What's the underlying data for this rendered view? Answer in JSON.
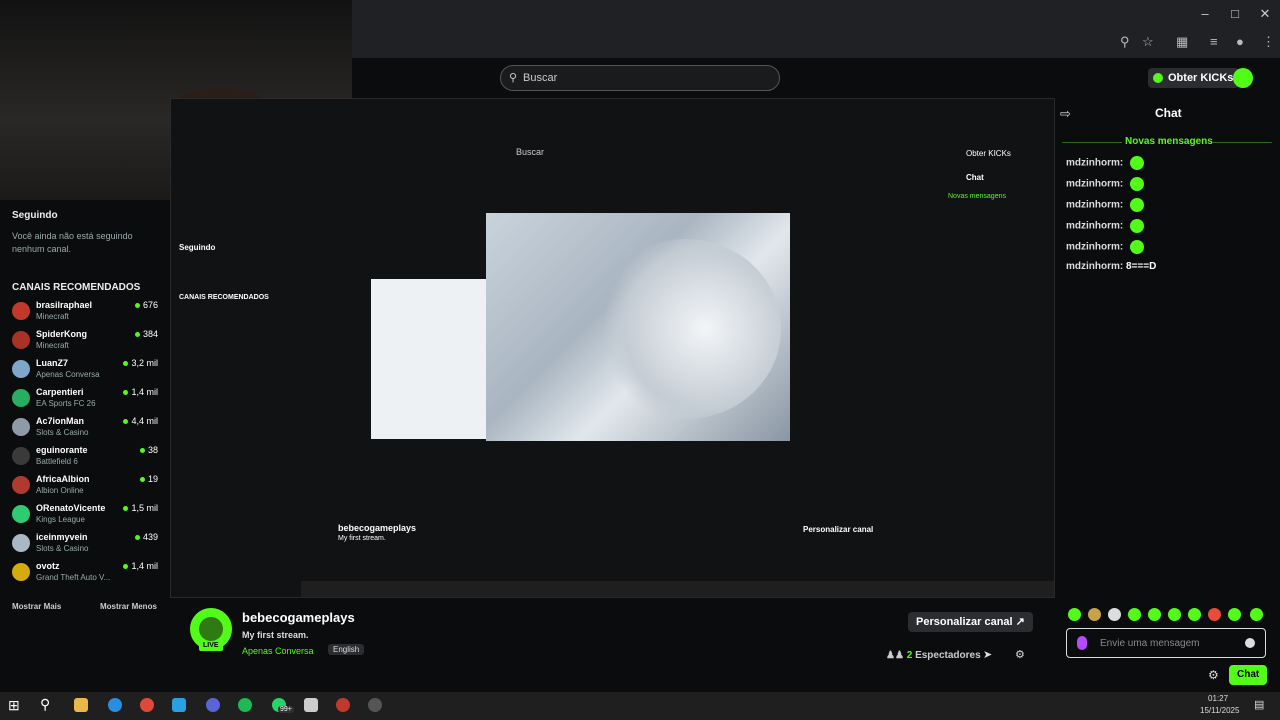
{
  "header": {
    "search_placeholder": "Buscar",
    "obter_kicks": "Obter KICKs"
  },
  "sidebar": {
    "following_title": "Seguindo",
    "following_note": "Você ainda não está seguindo nenhum canal.",
    "recommended_title": "CANAIS RECOMENDADOS",
    "channels": [
      {
        "name": "brasilraphael",
        "category": "Minecraft",
        "viewers": "676",
        "color": "#c0392b"
      },
      {
        "name": "SpiderKong",
        "category": "Minecraft",
        "viewers": "384",
        "color": "#a93226"
      },
      {
        "name": "LuanZ7",
        "category": "Apenas Conversa",
        "viewers": "3,2 mil",
        "color": "#7fa6c9"
      },
      {
        "name": "Carpentieri",
        "category": "EA Sports FC 26",
        "viewers": "1,4 mil",
        "color": "#27ae60"
      },
      {
        "name": "Ac7ionMan",
        "category": "Slots & Casino",
        "viewers": "4,4 mil",
        "color": "#8e9aa6"
      },
      {
        "name": "eguinorante",
        "category": "Battlefield 6",
        "viewers": "38",
        "color": "#3a3a3a"
      },
      {
        "name": "AfricaAlbion",
        "category": "Albion Online",
        "viewers": "19",
        "color": "#b03a2e"
      },
      {
        "name": "ORenatoVicente",
        "category": "Kings League",
        "viewers": "1,5 mil",
        "color": "#2ecc71"
      },
      {
        "name": "iceinmyvein",
        "category": "Slots & Casino",
        "viewers": "439",
        "color": "#aab7c4"
      },
      {
        "name": "ovotz",
        "category": "Grand Theft Auto V...",
        "viewers": "1,4 mil",
        "color": "#d4ac0d"
      }
    ],
    "show_more": "Mostrar Mais",
    "show_less": "Mostrar Menos"
  },
  "chat": {
    "title": "Chat",
    "new_messages": "Novas mensagens",
    "messages": [
      {
        "user": "mdzinhorm:",
        "text": ""
      },
      {
        "user": "mdzinhorm:",
        "text": ""
      },
      {
        "user": "mdzinhorm:",
        "text": ""
      },
      {
        "user": "mdzinhorm:",
        "text": ""
      },
      {
        "user": "mdzinhorm:",
        "text": ""
      },
      {
        "user": "mdzinhorm:",
        "text": "8===D"
      }
    ],
    "input_placeholder": "Envie uma mensagem",
    "send_label": "Chat"
  },
  "stream": {
    "streamer": "bebecogameplays",
    "title": "My first stream.",
    "category": "Apenas Conversa",
    "language": "English",
    "live": "LIVE",
    "customize": "Personalizar canal",
    "viewers_count": "2",
    "viewers_label": "Espectadores"
  },
  "taskbar": {
    "time": "01:27",
    "date": "15/11/2025",
    "badge": "99+"
  },
  "colors": {
    "accent": "#53fc18",
    "background": "#0b0c0d"
  }
}
